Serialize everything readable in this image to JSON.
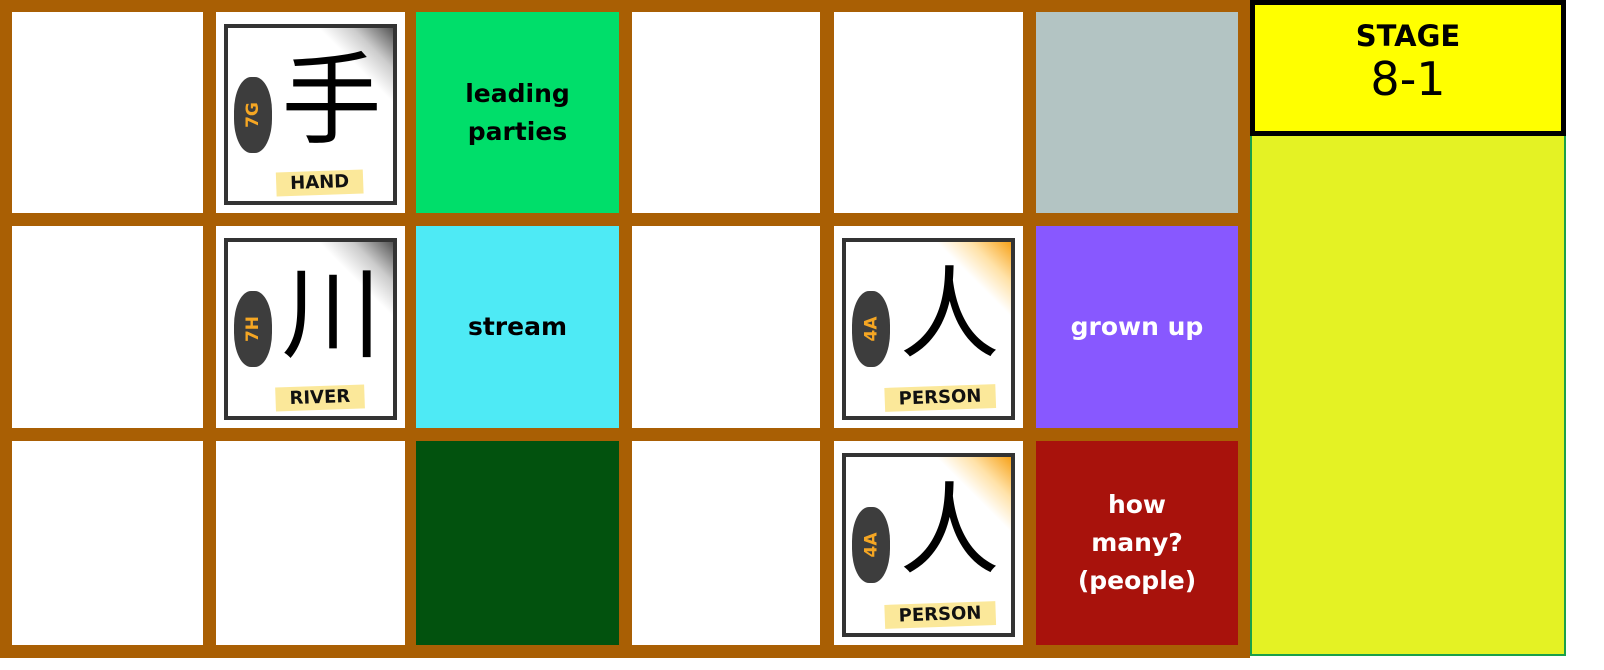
{
  "stage": {
    "label": "STAGE",
    "number": "8-1"
  },
  "cells": {
    "r0c1": {
      "code": "7G",
      "kanji": "手",
      "label": "HAND"
    },
    "r0c2": {
      "text": "leading parties",
      "color": "#00DE6A"
    },
    "r0c5": {
      "color": "#B3C4C3"
    },
    "r1c1": {
      "code": "7H",
      "kanji": "川",
      "label": "RIVER"
    },
    "r1c2": {
      "text": "stream",
      "color": "#4EEAF5"
    },
    "r1c4": {
      "code": "4A",
      "kanji": "人",
      "label": "PERSON"
    },
    "r1c5": {
      "text": "grown up",
      "color": "#8858FF"
    },
    "r2c2": {
      "color": "#02520E"
    },
    "r2c4": {
      "code": "4A",
      "kanji": "人",
      "label": "PERSON"
    },
    "r2c5": {
      "text": "how many? (people)",
      "color": "#A8120C"
    }
  },
  "colors": {
    "border": "#A95F04",
    "panel": "#E4F224",
    "stage": "#FFFF00"
  }
}
